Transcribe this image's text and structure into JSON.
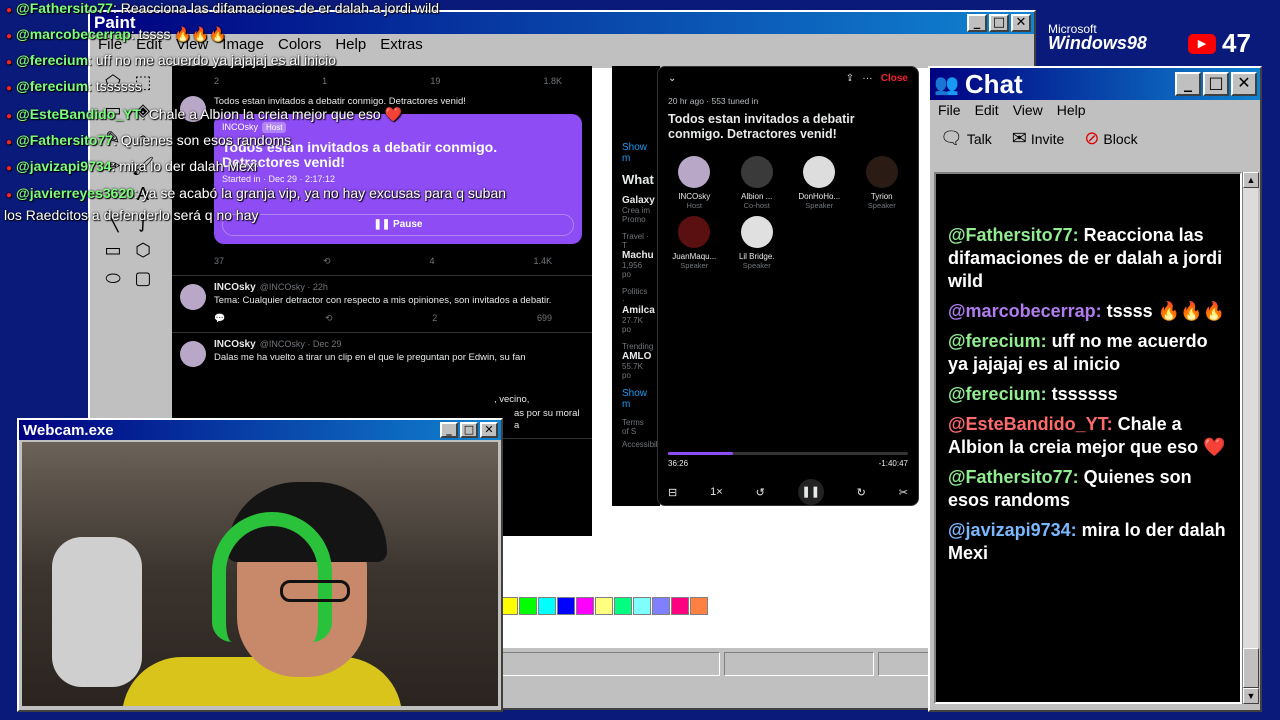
{
  "overlay_chat": [
    {
      "user": "@Fathersito77",
      "text": ": Reacciona las difamaciones de er dalah a jordi wild"
    },
    {
      "user": "@marcobecerrap",
      "text": ": tssss 🔥🔥🔥"
    },
    {
      "user": "@ferecium",
      "text": ": uff no me acuerdo ya jajajaj es al inicio"
    },
    {
      "user": "@ferecium",
      "text": ": tssssss"
    },
    {
      "user": "@EsteBandido_YT",
      "text": ": Chale a Albion la creia mejor que eso ❤️"
    },
    {
      "user": "@Fathersito77",
      "text": ": Quienes son esos randoms"
    },
    {
      "user": "@javizapi9734",
      "text": ": mira lo der dalah Mexi"
    },
    {
      "user": "@javierreyes3620",
      "text": ": ya se acabó la granja vip, ya no hay excusas para q suban"
    },
    {
      "user": "",
      "text": "los Raedcitos a defenderlo será q no hay"
    }
  ],
  "paint": {
    "title": "Paint",
    "menu": [
      "File",
      "Edit",
      "View",
      "Image",
      "Colors",
      "Help",
      "Extras"
    ],
    "palette": [
      "#ffff00",
      "#00ff00",
      "#00ffff",
      "#0000ff",
      "#ff00ff",
      "#ffff80",
      "#00ff80",
      "#80ffff",
      "#8080ff",
      "#ff0080",
      "#ff8040"
    ]
  },
  "feed": {
    "tweet1": {
      "body": "Todos estan invitados a debatir conmigo. Detractores venid!",
      "space_host": "INCOsky",
      "host_tag": "Host",
      "space_title": "Todos estan invitados a debatir conmigo. Detractores venid!",
      "started": "Started in · Dec 29 · 2:17:12",
      "pause": "Pause",
      "replies": "37",
      "likes": "4",
      "views": "1.4K"
    },
    "tweet0": {
      "replies": "2",
      "reposts": "1",
      "likes": "19",
      "views": "1.8K"
    },
    "tweet2": {
      "name": "INCOsky",
      "handle": "@INCOsky · 22h",
      "body": "Tema: Cualquier detractor con respecto a mis opiniones, son invitados a debatir.",
      "likes": "2",
      "views": "699"
    },
    "tweet3": {
      "name": "INCOsky",
      "handle": "@INCOsky · Dec 29",
      "body": "Dalas me ha vuelto a tirar un clip en el que le preguntan por Edwin, su fan"
    },
    "tweet3_frag": ", vecino,",
    "tweet3_frag2": "as por su moral a"
  },
  "side": {
    "show_more": "Show m",
    "whats": "What",
    "items": [
      {
        "a": "Galaxy",
        "b": "Crea im",
        "c": "Promo"
      },
      {
        "a": "Travel · T",
        "b": "Machu",
        "c": "1,956 po"
      },
      {
        "a": "Politics ·",
        "b": "Amilca",
        "c": "27.7K po"
      },
      {
        "a": "Trending",
        "b": "AMLO",
        "c": "55.7K po"
      }
    ],
    "show_more2": "Show m",
    "terms": "Terms of S",
    "access": "Accessibil"
  },
  "space": {
    "close": "Close",
    "meta": "20 hr ago · 553 tuned in",
    "title": "Todos estan invitados a debatir conmigo. Detractores venid!",
    "speakers": [
      {
        "name": "INCOsky",
        "role": "Host",
        "color": "#b9a7c7"
      },
      {
        "name": "Albion ...",
        "role": "Co-host",
        "color": "#3a3a3a"
      },
      {
        "name": "DonHoHo...",
        "role": "Speaker",
        "color": "#dddddd"
      },
      {
        "name": "Tyrion",
        "role": "Speaker",
        "color": "#2a1c14"
      },
      {
        "name": "JuanMaqu...",
        "role": "Speaker",
        "color": "#5a1010"
      },
      {
        "name": "Lil Bridge.",
        "role": "Speaker",
        "color": "#e0e0e0"
      }
    ],
    "progress": 0.27,
    "elapsed": "36:26",
    "remaining": "-1:40:47",
    "speed": "1×"
  },
  "branding": {
    "ms": "Microsoft",
    "win": "Windows98",
    "viewers": "47"
  },
  "chat": {
    "title": "Chat",
    "menu": [
      "File",
      "Edit",
      "View",
      "Help"
    ],
    "talk": "Talk",
    "invite": "Invite",
    "block": "Block",
    "messages": [
      {
        "user": "@Fathersito77:",
        "text": " Reacciona las difamaciones de er dalah a jordi wild",
        "color": "#90ee90"
      },
      {
        "user": "@marcobecerrap:",
        "text": " tssss 🔥🔥🔥",
        "color": "#b07cf0"
      },
      {
        "user": "@ferecium:",
        "text": " uff no me acuerdo ya jajajaj es al inicio",
        "color": "#90ee90"
      },
      {
        "user": "@ferecium:",
        "text": " tssssss",
        "color": "#90ee90"
      },
      {
        "user": "@EsteBandido_YT:",
        "text": " Chale a Albion la creia mejor que eso ❤️",
        "color": "#ff6b6b"
      },
      {
        "user": "@Fathersito77:",
        "text": " Quienes son esos randoms",
        "color": "#90ee90"
      },
      {
        "user": "@javizapi9734:",
        "text": " mira lo der dalah Mexi",
        "color": "#7ab8ff"
      }
    ]
  },
  "webcam": {
    "title": "Webcam.exe"
  }
}
